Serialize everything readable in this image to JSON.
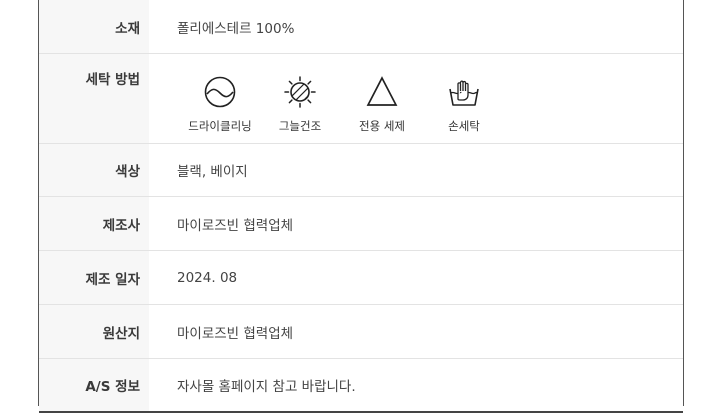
{
  "rows": [
    {
      "label": "소재",
      "value": "폴리에스테르 100%"
    },
    {
      "label": "세탁 방법"
    },
    {
      "label": "색상",
      "value": "블랙, 베이지"
    },
    {
      "label": "제조사",
      "value": "마이로즈빈 협력업체"
    },
    {
      "label": "제조 일자",
      "value": "2024. 08"
    },
    {
      "label": "원산지",
      "value": "마이로즈빈 협력업체"
    },
    {
      "label": "A/S 정보",
      "value": "자사몰 홈페이지 참고 바랍니다."
    }
  ],
  "care": [
    {
      "icon": "dry-cleaning-icon",
      "label": "드라이클리닝"
    },
    {
      "icon": "shade-dry-icon",
      "label": "그늘건조"
    },
    {
      "icon": "special-detergent-icon",
      "label": "전용 세제"
    },
    {
      "icon": "hand-wash-icon",
      "label": "손세탁"
    }
  ]
}
